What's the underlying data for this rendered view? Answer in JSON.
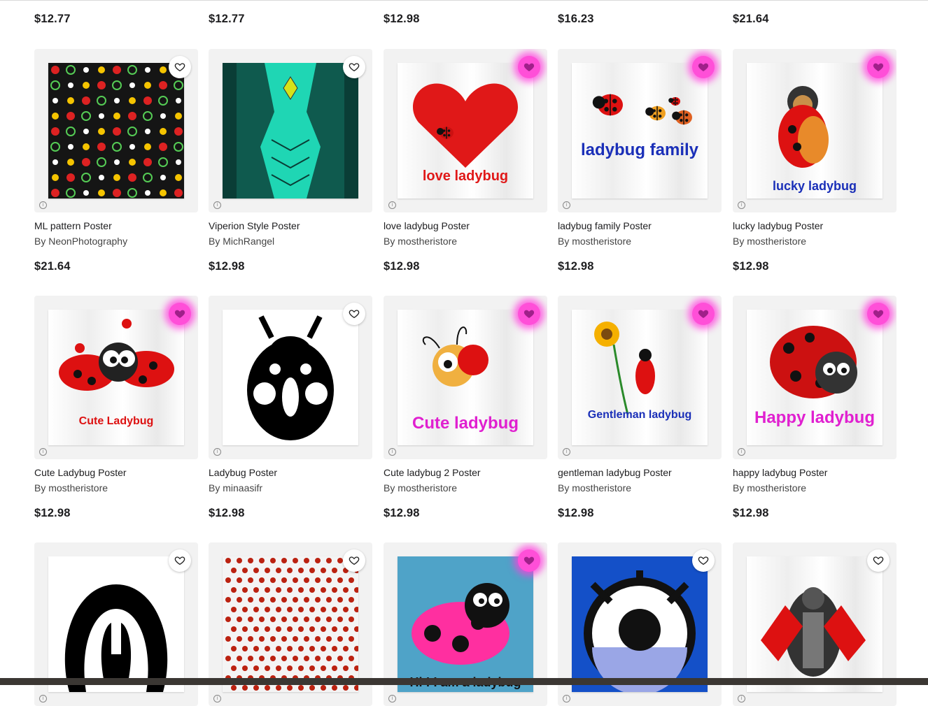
{
  "top_prices": [
    "$12.77",
    "$12.77",
    "$12.98",
    "$16.23",
    "$21.64"
  ],
  "products": [
    {
      "title": "ML pattern Poster",
      "artist": "By NeonPhotography",
      "price": "$21.64",
      "favorited": false,
      "poster_text": ""
    },
    {
      "title": "Viperion Style Poster",
      "artist": "By MichRangel",
      "price": "$12.98",
      "favorited": false,
      "poster_text": ""
    },
    {
      "title": "love ladybug Poster",
      "artist": "By mostheristore",
      "price": "$12.98",
      "favorited": true,
      "poster_text": "love ladybug"
    },
    {
      "title": "ladybug family Poster",
      "artist": "By mostheristore",
      "price": "$12.98",
      "favorited": true,
      "poster_text": "ladybug family"
    },
    {
      "title": "lucky ladybug Poster",
      "artist": "By mostheristore",
      "price": "$12.98",
      "favorited": true,
      "poster_text": "lucky ladybug"
    },
    {
      "title": "Cute Ladybug Poster",
      "artist": "By mostheristore",
      "price": "$12.98",
      "favorited": true,
      "poster_text": "Cute Ladybug"
    },
    {
      "title": "Ladybug Poster",
      "artist": "By minaasifr",
      "price": "$12.98",
      "favorited": false,
      "poster_text": ""
    },
    {
      "title": "Cute ladybug 2 Poster",
      "artist": "By mostheristore",
      "price": "$12.98",
      "favorited": true,
      "poster_text": "Cute ladybug"
    },
    {
      "title": "gentleman ladybug Poster",
      "artist": "By mostheristore",
      "price": "$12.98",
      "favorited": true,
      "poster_text": "Gentleman ladybug"
    },
    {
      "title": "happy ladybug Poster",
      "artist": "By mostheristore",
      "price": "$12.98",
      "favorited": true,
      "poster_text": "Happy ladybug"
    },
    {
      "favorited": false,
      "poster_text": ""
    },
    {
      "favorited": false,
      "poster_text": ""
    },
    {
      "favorited": true,
      "poster_text": "Hi ! I am a ladybug"
    },
    {
      "favorited": false,
      "poster_text": ""
    },
    {
      "favorited": false,
      "poster_text": ""
    }
  ],
  "icons": {
    "favorite": "heart-outline-icon",
    "favorited": "heart-filled-icon",
    "info": "info-icon"
  },
  "colors": {
    "favorite_glow": "#ff3cdc",
    "price": "#1d1d1f",
    "thumb_bg": "#f2f2f2"
  }
}
